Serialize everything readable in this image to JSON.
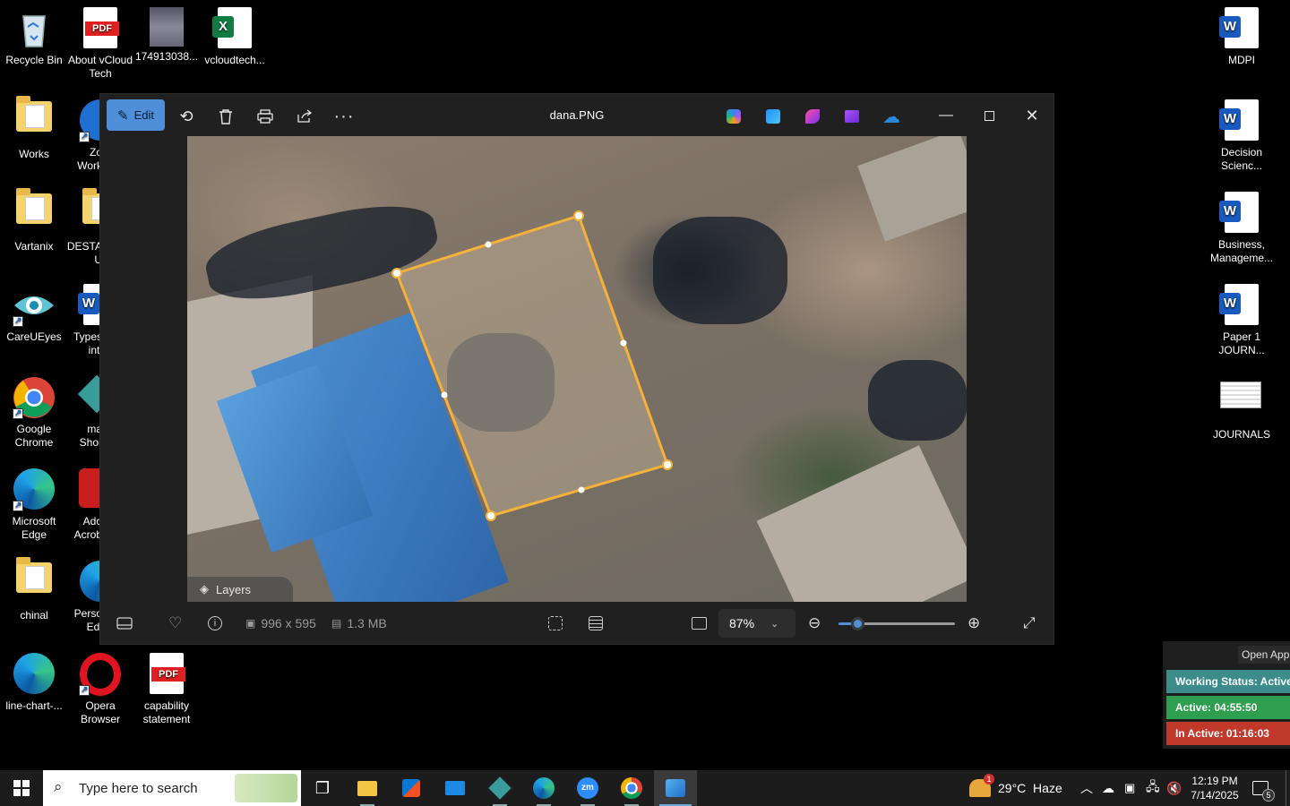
{
  "desktop": {
    "left_icons": [
      {
        "label": "Recycle Bin"
      },
      {
        "label": "About vCloud Tech"
      },
      {
        "label": "174913038..."
      },
      {
        "label": "vcloudtech..."
      },
      {
        "label": "Works"
      },
      {
        "label": "Zo Work"
      },
      {
        "label": "Vartanix"
      },
      {
        "label": "DESTA U"
      },
      {
        "label": "CareUEyes"
      },
      {
        "label": "Types inti"
      },
      {
        "label": "Google Chrome"
      },
      {
        "label": "ma Shor"
      },
      {
        "label": "Microsoft Edge"
      },
      {
        "label": "Ado Acrob"
      },
      {
        "label": "chinal"
      },
      {
        "label": "Perso Edi"
      },
      {
        "label": "line-chart-..."
      },
      {
        "label": "Opera Browser"
      },
      {
        "label": "capability statement"
      }
    ],
    "right_icons": [
      {
        "label": "MDPI"
      },
      {
        "label": "Decision Scienc..."
      },
      {
        "label": "Business, Manageme..."
      },
      {
        "label": "Paper 1 JOURN..."
      },
      {
        "label": "JOURNALS"
      }
    ],
    "badges": {
      "pdf": "PDF",
      "word": "W",
      "excel": "X"
    }
  },
  "photos_window": {
    "edit_label": "Edit",
    "title": "dana.PNG",
    "layers_label": "Layers",
    "dimensions": "996 x 595",
    "file_size": "1.3 MB",
    "zoom": "87%",
    "zoom_level_fraction": 0.16
  },
  "status_widget": {
    "open_app": "Open App",
    "working_status": "Working Status: Active",
    "active": "Active: 04:55:50",
    "inactive": "In Active: 01:16:03",
    "colors": {
      "working": "#3d8c8c",
      "active": "#2e9e4f",
      "inactive": "#c0392b"
    }
  },
  "taskbar": {
    "search_placeholder": "Type here to search",
    "weather": "29°C  Haze",
    "weather_badge": "1",
    "time": "12:19 PM",
    "date": "7/14/2025",
    "notification_count": "5"
  }
}
